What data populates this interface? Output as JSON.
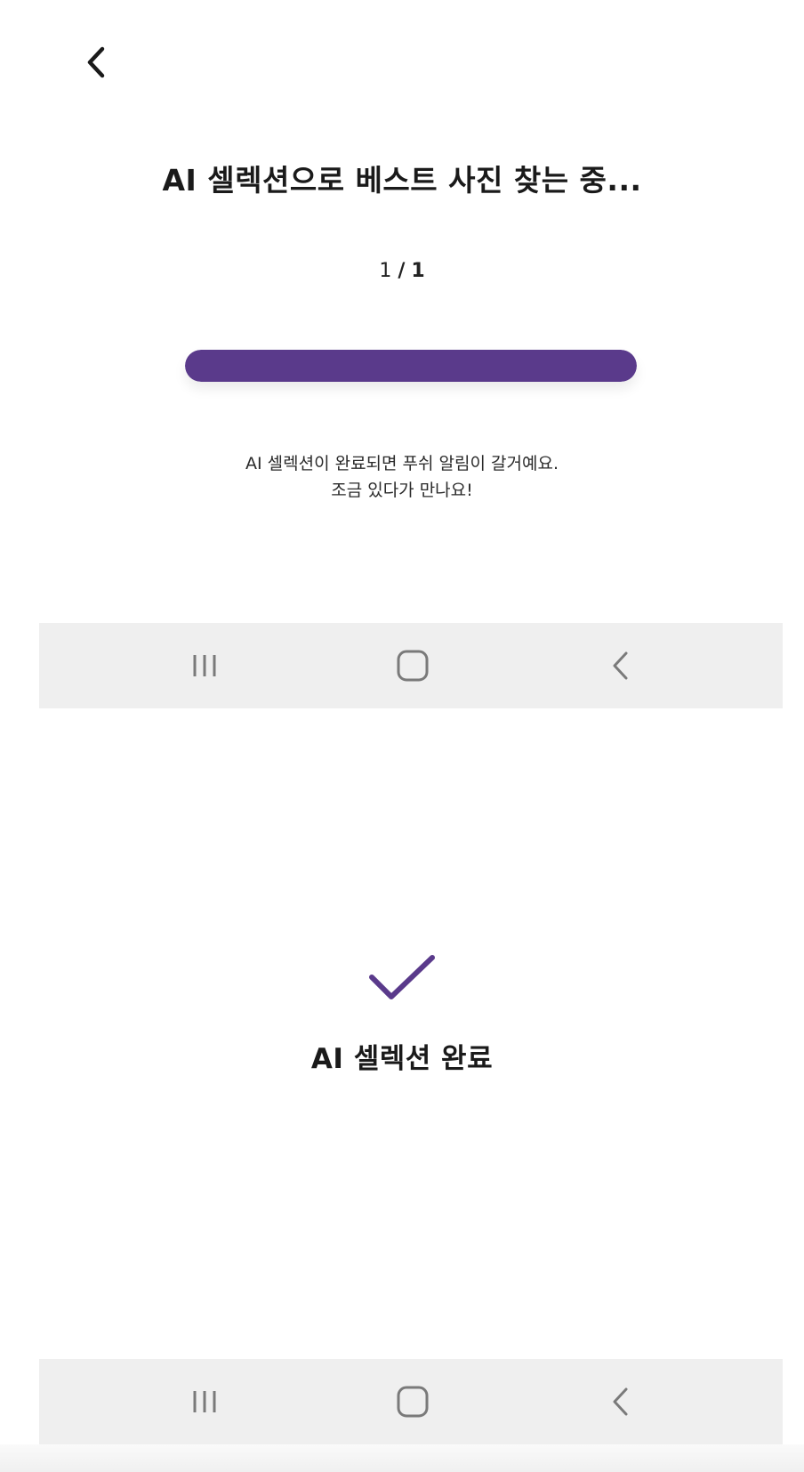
{
  "screen_progress": {
    "back_icon": "chevron-left-icon",
    "title": "AI 셀렉션으로 베스트 사진 찾는 중...",
    "counter": {
      "current": "1",
      "separator": "/",
      "total": "1"
    },
    "progress": {
      "fraction": 1.0,
      "fill_color": "#5a3a8b"
    },
    "info_line1": "AI 셀렉션이 완료되면 푸쉬 알림이 갈거예요.",
    "info_line2": "조금 있다가 만나요!"
  },
  "navigation_bar": {
    "recent_icon": "recent-apps-icon",
    "home_icon": "home-icon",
    "back_icon": "back-chevron-icon"
  },
  "screen_done": {
    "check_icon": "checkmark-icon",
    "check_color": "#5a3a8b",
    "title": "AI 셀렉션 완료"
  }
}
